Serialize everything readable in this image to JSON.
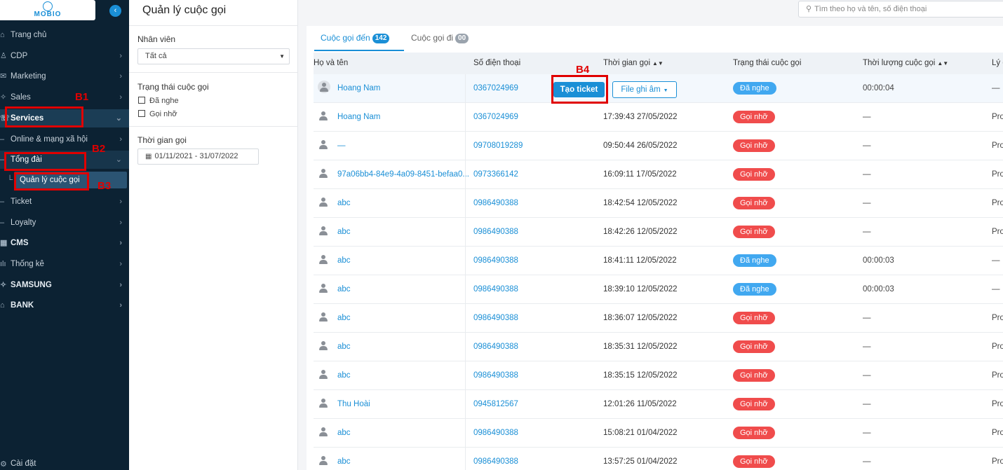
{
  "app": {
    "logo_text": "MOBIO",
    "collapse_icon": "chevron-left-icon"
  },
  "sidebar": {
    "items": [
      {
        "label": "Trang chủ",
        "icon": "home-icon"
      },
      {
        "label": "CDP",
        "icon": "user-icon"
      },
      {
        "label": "Marketing",
        "icon": "megaphone-icon"
      },
      {
        "label": "Sales",
        "icon": "tag-icon"
      },
      {
        "label": "Services",
        "icon": "headset-icon"
      },
      {
        "label": "Online & mạng xã hội",
        "icon": ""
      },
      {
        "label": "Tổng đài",
        "icon": ""
      },
      {
        "label": "Quản lý cuộc gọi",
        "icon": ""
      },
      {
        "label": "Ticket",
        "icon": ""
      },
      {
        "label": "Loyalty",
        "icon": ""
      },
      {
        "label": "CMS",
        "icon": "grid-icon"
      },
      {
        "label": "Thống kê",
        "icon": "chart-icon"
      },
      {
        "label": "SAMSUNG",
        "icon": "tag-icon"
      },
      {
        "label": "BANK",
        "icon": "bank-icon"
      }
    ],
    "settings_label": "Cài đặt"
  },
  "annotations": {
    "b1": "B1",
    "b2": "B2",
    "b3": "B3",
    "b4": "B4"
  },
  "filters": {
    "page_title": "Quản lý cuộc gọi",
    "employee_label": "Nhân viên",
    "employee_value": "Tất cả",
    "status_label": "Trạng thái cuộc gọi",
    "status_options": [
      "Đã nghe",
      "Gọi nhỡ"
    ],
    "time_label": "Thời gian gọi",
    "time_value": "01/11/2021 - 31/07/2022"
  },
  "search": {
    "placeholder": "Tìm theo họ và tên, số điện thoại"
  },
  "tabs": [
    {
      "label": "Cuộc gọi đến",
      "count": "142"
    },
    {
      "label": "Cuộc gọi đi",
      "count": "00"
    }
  ],
  "table": {
    "headers": [
      "Họ và tên",
      "Số điện thoại",
      "Thời gian gọi",
      "Trạng thái cuộc gọi",
      "Thời lượng cuộc gọi",
      "Lý d"
    ],
    "row_actions": {
      "create_ticket": "Tạo ticket",
      "recording": "File ghi âm"
    },
    "rows": [
      {
        "name": "Hoang Nam",
        "phone": "0367024969",
        "time": "",
        "status": "Đã nghe",
        "status_kind": "answered",
        "duration": "00:00:04",
        "reason": "—"
      },
      {
        "name": "Hoang Nam",
        "phone": "0367024969",
        "time": "17:39:43 27/05/2022",
        "status": "Gọi nhỡ",
        "status_kind": "missed",
        "duration": "—",
        "reason": "Pro"
      },
      {
        "name": "—",
        "phone": "09708019289",
        "time": "09:50:44 26/05/2022",
        "status": "Gọi nhỡ",
        "status_kind": "missed",
        "duration": "—",
        "reason": "Pro"
      },
      {
        "name": "97a06bb4-84e9-4a09-8451-befaa0...",
        "phone": "0973366142",
        "time": "16:09:11 17/05/2022",
        "status": "Gọi nhỡ",
        "status_kind": "missed",
        "duration": "—",
        "reason": "Pro"
      },
      {
        "name": "abc",
        "phone": "0986490388",
        "time": "18:42:54 12/05/2022",
        "status": "Gọi nhỡ",
        "status_kind": "missed",
        "duration": "—",
        "reason": "Pro"
      },
      {
        "name": "abc",
        "phone": "0986490388",
        "time": "18:42:26 12/05/2022",
        "status": "Gọi nhỡ",
        "status_kind": "missed",
        "duration": "—",
        "reason": "Pro"
      },
      {
        "name": "abc",
        "phone": "0986490388",
        "time": "18:41:11 12/05/2022",
        "status": "Đã nghe",
        "status_kind": "answered",
        "duration": "00:00:03",
        "reason": "—"
      },
      {
        "name": "abc",
        "phone": "0986490388",
        "time": "18:39:10 12/05/2022",
        "status": "Đã nghe",
        "status_kind": "answered",
        "duration": "00:00:03",
        "reason": "—"
      },
      {
        "name": "abc",
        "phone": "0986490388",
        "time": "18:36:07 12/05/2022",
        "status": "Gọi nhỡ",
        "status_kind": "missed",
        "duration": "—",
        "reason": "Pro"
      },
      {
        "name": "abc",
        "phone": "0986490388",
        "time": "18:35:31 12/05/2022",
        "status": "Gọi nhỡ",
        "status_kind": "missed",
        "duration": "—",
        "reason": "Pro"
      },
      {
        "name": "abc",
        "phone": "0986490388",
        "time": "18:35:15 12/05/2022",
        "status": "Gọi nhỡ",
        "status_kind": "missed",
        "duration": "—",
        "reason": "Pro"
      },
      {
        "name": "Thu Hoài",
        "phone": "0945812567",
        "time": "12:01:26 11/05/2022",
        "status": "Gọi nhỡ",
        "status_kind": "missed",
        "duration": "—",
        "reason": "Pro"
      },
      {
        "name": "abc",
        "phone": "0986490388",
        "time": "15:08:21 01/04/2022",
        "status": "Gọi nhỡ",
        "status_kind": "missed",
        "duration": "—",
        "reason": "Pro"
      },
      {
        "name": "abc",
        "phone": "0986490388",
        "time": "13:57:25 01/04/2022",
        "status": "Gọi nhỡ",
        "status_kind": "missed",
        "duration": "—",
        "reason": "Pro"
      }
    ]
  },
  "colors": {
    "sidebar_bg": "#0c2233",
    "accent": "#1a8fd6",
    "answered": "#41a8f0",
    "missed": "#f04c4c",
    "annotation": "#e00000"
  }
}
